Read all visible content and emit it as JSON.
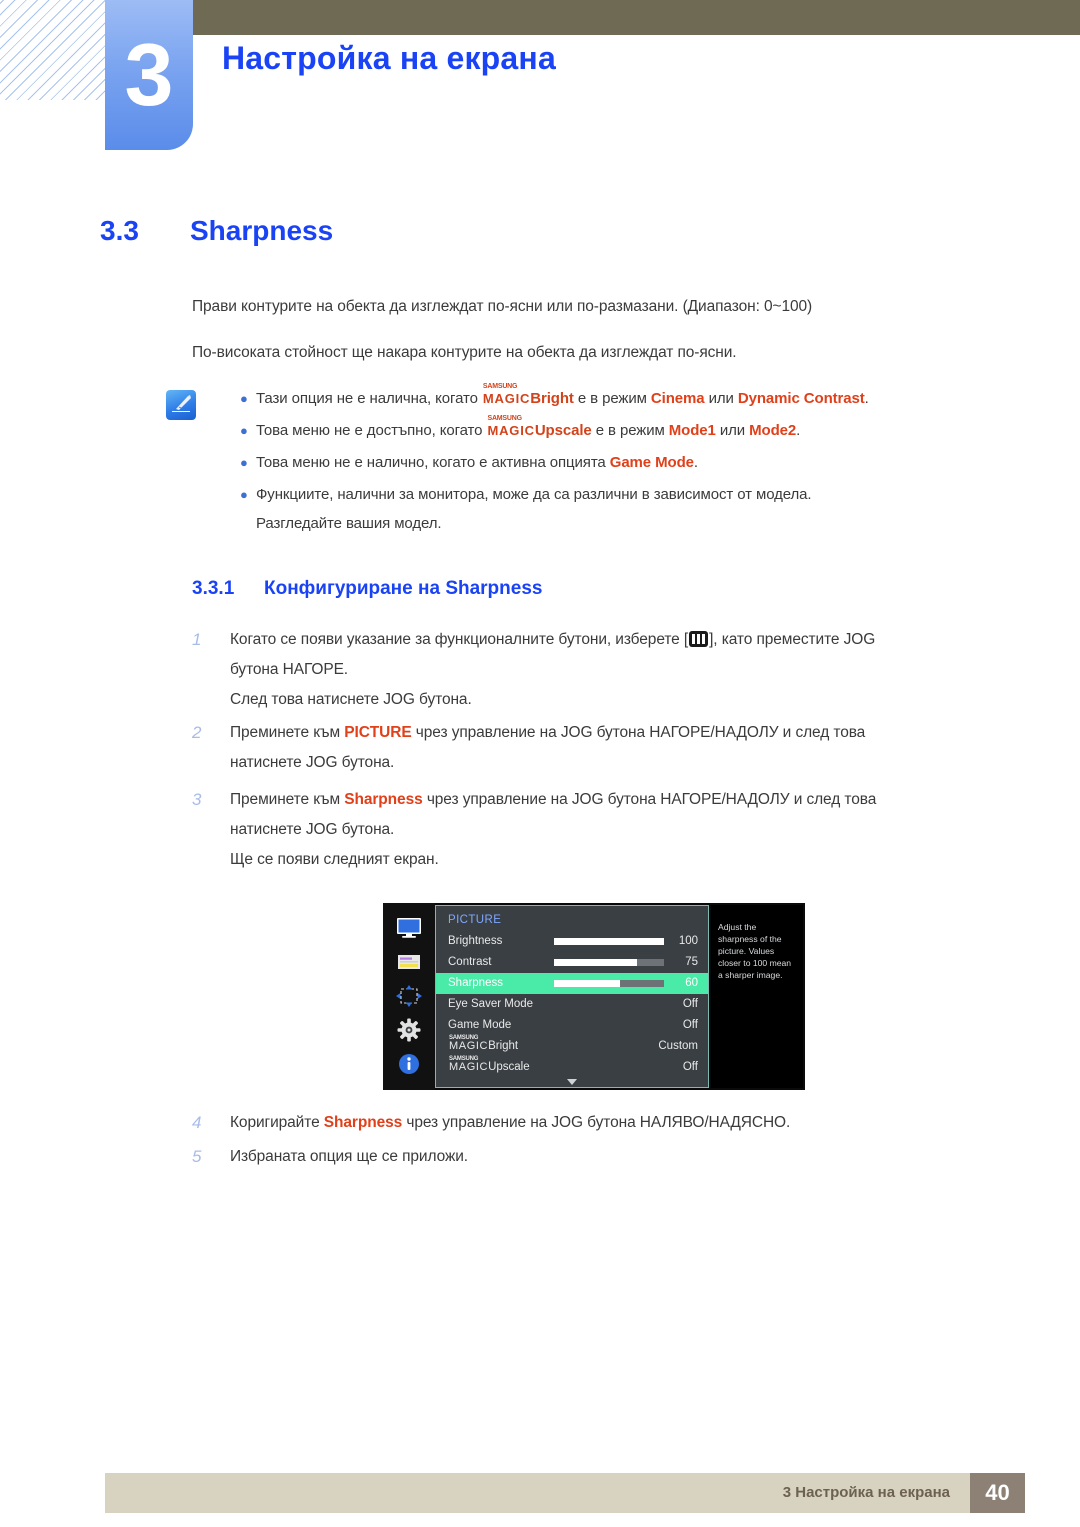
{
  "header": {
    "chapter_number": "3",
    "chapter_title": "Настройка на екрана",
    "hatch_icon": "diagonal-hatch-pattern"
  },
  "section": {
    "number": "3.3",
    "title": "Sharpness",
    "paragraph_1": "Прави контурите на обекта да изглеждат по-ясни или по-размазани. (Диапазон: 0~100)",
    "paragraph_2": "По-високата стойност ще накара контурите на обекта да изглеждат по-ясни."
  },
  "note": {
    "icon": "note-pencil-icon",
    "bullet_glyph": "•",
    "items": [
      {
        "prefix": "Тази опция не е налична, когато ",
        "magic_top": "SAMSUNG",
        "magic_main": "MAGIC",
        "magic_suffix": "Bright",
        "middle": " е в режим ",
        "highlight_1": "Cinema",
        "conj": " или ",
        "highlight_2": "Dynamic Contrast",
        "suffix": "."
      },
      {
        "prefix": "Това меню не е достъпно, когато ",
        "magic_top": "SAMSUNG",
        "magic_main": "MAGIC",
        "magic_suffix": "Upscale",
        "middle": " е в режим ",
        "highlight_1": "Mode1",
        "conj": " или ",
        "highlight_2": "Mode2",
        "suffix": "."
      },
      {
        "prefix": "Това меню не е налично, когато е активна опцията ",
        "highlight_1": "Game Mode",
        "suffix": "."
      },
      {
        "prefix": "Функциите, налични за монитора, може да са различни в зависимост от модела.",
        "second_line": "Разгледайте вашия модел."
      }
    ]
  },
  "subsection": {
    "number": "3.3.1",
    "title": "Конфигуриране на Sharpness"
  },
  "steps": [
    {
      "num": "1",
      "part_a": "Когато се появи указание за функционалните бутони, изберете [",
      "icon": "menu-bars-icon",
      "part_b": "], като преместите JOG",
      "line2": "бутона НАГОРЕ.",
      "line3": "След това натиснете JOG бутона."
    },
    {
      "num": "2",
      "part_a": "Преминете към ",
      "highlight": "PICTURE",
      "part_b": " чрез управление на JOG бутона НАГОРЕ/НАДОЛУ и след това",
      "line2": "натиснете JOG бутона."
    },
    {
      "num": "3",
      "part_a": "Преминете към ",
      "highlight": "Sharpness",
      "part_b": " чрез управление на JOG бутона НАГОРЕ/НАДОЛУ и след това",
      "line2": "натиснете JOG бутона.",
      "line3": "Ще се появи следният екран."
    },
    {
      "num": "4",
      "part_a": "Коригирайте ",
      "highlight": "Sharpness",
      "part_b": " чрез управление на JOG бутона НАЛЯВО/НАДЯСНО."
    },
    {
      "num": "5",
      "part_a": "Избраната опция ще се приложи."
    }
  ],
  "osd": {
    "title": "PICTURE",
    "title_color": "#7fa8ff",
    "highlight_color": "#4aeba8",
    "rail_icons": [
      "monitor-picture-icon",
      "osd-display-icon",
      "position-arrows-icon",
      "gear-settings-icon",
      "info-circle-icon"
    ],
    "rows": [
      {
        "label": "Brightness",
        "value": "100",
        "bar": true,
        "fill_pct": 100,
        "selected": false
      },
      {
        "label": "Contrast",
        "value": "75",
        "bar": true,
        "fill_pct": 75,
        "selected": false
      },
      {
        "label": "Sharpness",
        "value": "60",
        "bar": true,
        "fill_pct": 60,
        "selected": true
      },
      {
        "label": "Eye Saver Mode",
        "value": "Off",
        "bar": false,
        "selected": false
      },
      {
        "label": "Game Mode",
        "value": "Off",
        "bar": false,
        "selected": false
      },
      {
        "label": "MAGICBright",
        "magic_top": "SAMSUNG",
        "magic_main": "MAGIC",
        "magic_suffix": "Bright",
        "value": "Custom",
        "bar": false,
        "selected": false
      },
      {
        "label": "MAGICUpscale",
        "magic_top": "SAMSUNG",
        "magic_main": "MAGIC",
        "magic_suffix": "Upscale",
        "value": "Off",
        "bar": false,
        "selected": false
      }
    ],
    "scroll_arrow": "chevron-down-icon",
    "help_text": "Adjust the sharpness of the picture. Values closer to 100 mean a sharper image."
  },
  "footer": {
    "text": "3 Настройка на екрана",
    "page": "40"
  }
}
